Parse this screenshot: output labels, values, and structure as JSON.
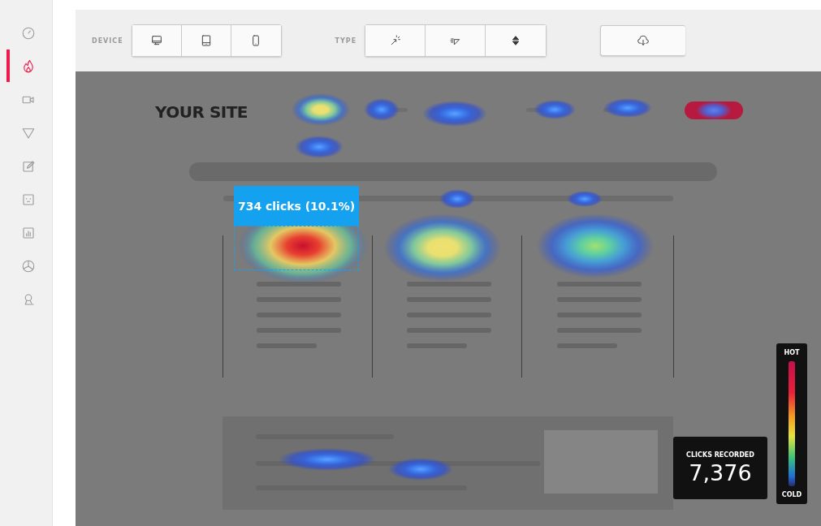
{
  "sidebar": {
    "items": [
      {
        "kind": "dashboard",
        "selected": false
      },
      {
        "kind": "heatmap",
        "selected": true
      },
      {
        "kind": "recording",
        "selected": false
      },
      {
        "kind": "funnel",
        "selected": false
      },
      {
        "kind": "form",
        "selected": false
      },
      {
        "kind": "feedback",
        "selected": false
      },
      {
        "kind": "report",
        "selected": false
      },
      {
        "kind": "poll",
        "selected": false
      },
      {
        "kind": "user",
        "selected": false
      }
    ]
  },
  "toolbar": {
    "device_label": "DEVICE",
    "devices": [
      {
        "kind": "desktop"
      },
      {
        "kind": "tablet"
      },
      {
        "kind": "phone"
      }
    ],
    "type_label": "TYPE",
    "types": [
      {
        "kind": "click"
      },
      {
        "kind": "move"
      },
      {
        "kind": "scroll"
      }
    ],
    "download": {
      "kind": "download"
    }
  },
  "site": {
    "logo": "YOUR SITE"
  },
  "tooltip": "734 clicks (10.1%)",
  "stats": {
    "label": "CLICKS RECORDED",
    "value": "7,376"
  },
  "legend": {
    "hot": "HOT",
    "cold": "COLD"
  }
}
